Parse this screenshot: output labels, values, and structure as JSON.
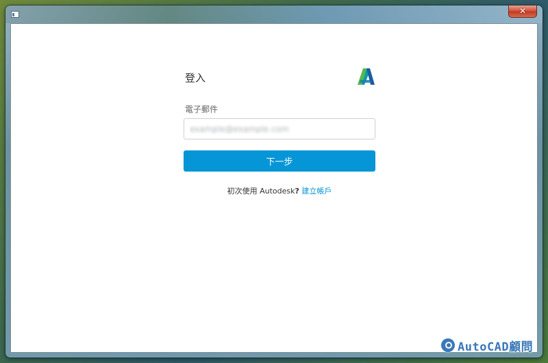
{
  "window": {
    "close_glyph": "✕"
  },
  "login": {
    "title": "登入",
    "logo_name": "autodesk-logo",
    "email_label": "電子郵件",
    "email_value": "example@example.com",
    "next_button_label": "下一步",
    "signup_prefix": "初次使用 Autodesk",
    "signup_question": "?",
    "signup_link": "建立帳戶"
  },
  "watermark": {
    "text": "AutoCAD顧問"
  },
  "colors": {
    "accent": "#0696d7",
    "logo_green": "#56b847",
    "logo_teal": "#0e9aa7",
    "logo_blue": "#1a5ea0"
  }
}
